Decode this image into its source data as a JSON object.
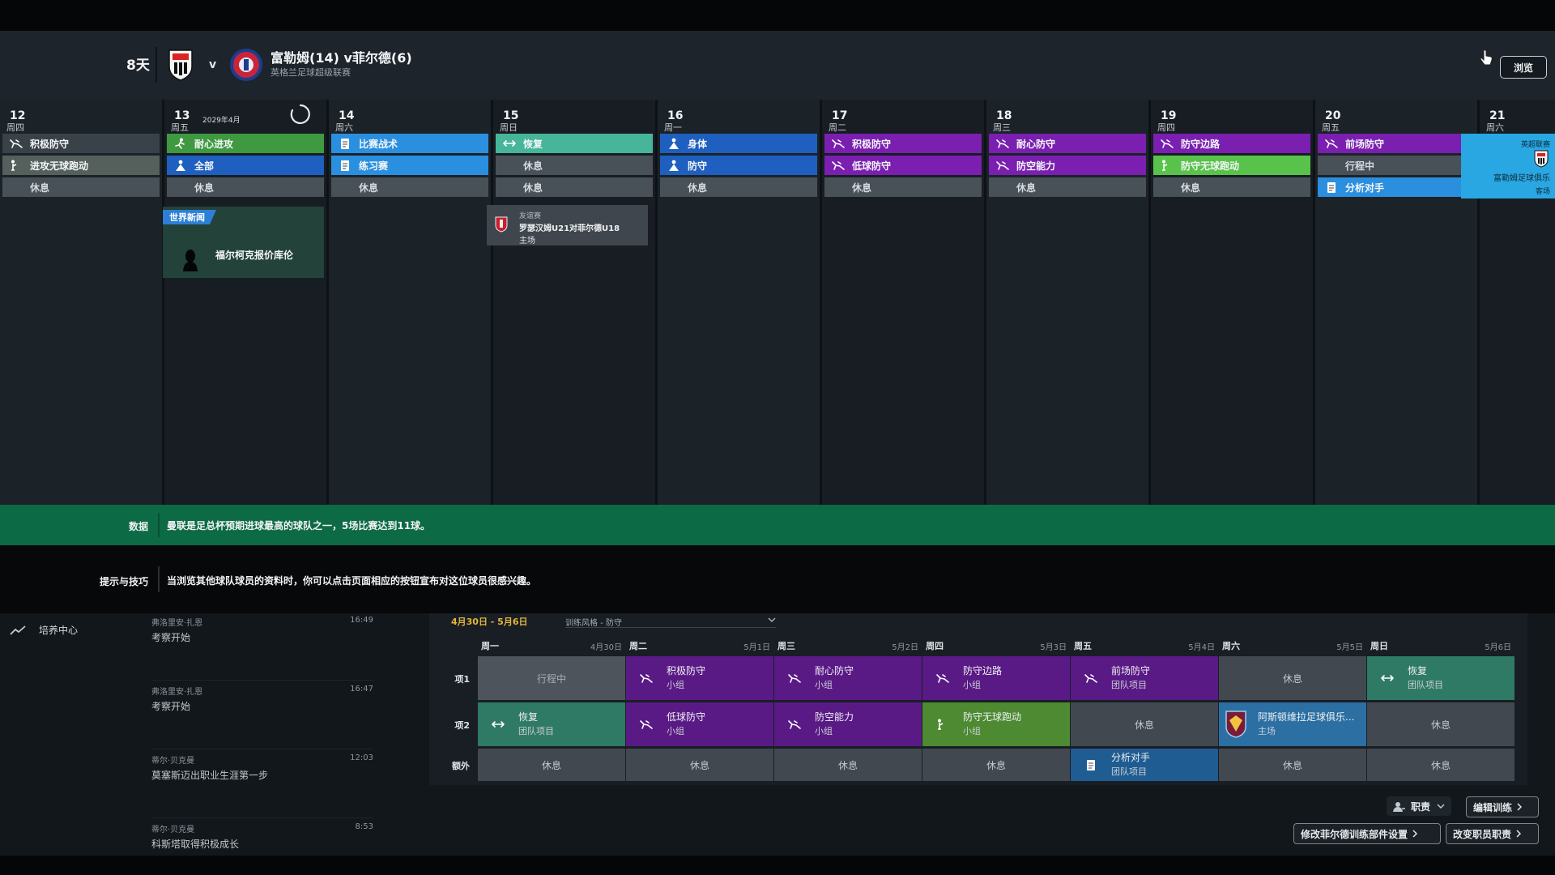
{
  "header": {
    "days_left": "8天",
    "vs": "v",
    "match_title": "富勒姆(14) v菲尔德(6)",
    "match_subtitle": "英格兰足球超级联赛",
    "browse_label": "浏览"
  },
  "calendar": {
    "month_label": "2029年4月",
    "days": [
      {
        "num": "12",
        "weekday": "周四",
        "slots": [
          {
            "label": "积极防守",
            "color": "#3a4249",
            "icon": "defend-icon"
          },
          {
            "label": "进攻无球跑动",
            "color": "#55605c",
            "icon": "run-icon"
          },
          {
            "label": "休息",
            "rest": true
          }
        ]
      },
      {
        "num": "13",
        "weekday": "周五",
        "slots": [
          {
            "label": "耐心进攻",
            "color": "#3f9940",
            "icon": "attack-icon"
          },
          {
            "label": "全部",
            "color": "#1f5fbf",
            "icon": "person-icon"
          },
          {
            "label": "休息",
            "rest": true
          }
        ]
      },
      {
        "num": "14",
        "weekday": "周六",
        "slots": [
          {
            "label": "比赛战术",
            "color": "#2b8fe0",
            "icon": "tactics-icon"
          },
          {
            "label": "练习赛",
            "color": "#2b8fe0",
            "icon": "tactics-icon"
          },
          {
            "label": "休息",
            "rest": true
          }
        ]
      },
      {
        "num": "15",
        "weekday": "周日",
        "slots": [
          {
            "label": "恢复",
            "color": "#46b59a",
            "icon": "recovery-icon"
          },
          {
            "label": "休息",
            "rest": true
          },
          {
            "label": "休息",
            "rest": true
          }
        ]
      },
      {
        "num": "16",
        "weekday": "周一",
        "slots": [
          {
            "label": "身体",
            "color": "#1f5fbf",
            "icon": "person-icon"
          },
          {
            "label": "防守",
            "color": "#1f5fbf",
            "icon": "person-icon"
          },
          {
            "label": "休息",
            "rest": true
          }
        ]
      },
      {
        "num": "17",
        "weekday": "周二",
        "slots": [
          {
            "label": "积极防守",
            "color": "#7a1fb0",
            "icon": "defend-icon"
          },
          {
            "label": "低球防守",
            "color": "#7a1fb0",
            "icon": "defend-icon"
          },
          {
            "label": "休息",
            "rest": true
          }
        ]
      },
      {
        "num": "18",
        "weekday": "周三",
        "slots": [
          {
            "label": "耐心防守",
            "color": "#7a1fb0",
            "icon": "defend-icon"
          },
          {
            "label": "防空能力",
            "color": "#7a1fb0",
            "icon": "defend-icon"
          },
          {
            "label": "休息",
            "rest": true
          }
        ]
      },
      {
        "num": "19",
        "weekday": "周四",
        "slots": [
          {
            "label": "防守边路",
            "color": "#7a1fb0",
            "icon": "defend-icon"
          },
          {
            "label": "防守无球跑动",
            "color": "#58c24a",
            "icon": "run-icon"
          },
          {
            "label": "休息",
            "rest": true
          }
        ]
      },
      {
        "num": "20",
        "weekday": "周五",
        "slots": [
          {
            "label": "前场防守",
            "color": "#7a1fb0",
            "icon": "defend-icon"
          },
          {
            "label": "行程中",
            "rest": true
          },
          {
            "label": "分析对手",
            "color": "#2b8fe0",
            "icon": "tactics-icon"
          }
        ]
      },
      {
        "num": "21",
        "weekday": "周六",
        "slots": []
      }
    ],
    "news": {
      "tag": "世界新闻",
      "text": "福尔柯克报价库伦"
    },
    "friendly": {
      "type": "友谊赛",
      "title": "罗瑟汉姆U21对菲尔德U18",
      "venue": "主场"
    },
    "match_card": {
      "competition": "英超联赛",
      "title": "富勒姆足球俱乐",
      "venue": "客场"
    }
  },
  "banners": {
    "data_label": "数据",
    "data_text": "曼联是足总杯预期进球最高的球队之一，5场比赛达到11球。",
    "tips_label": "提示与技巧",
    "tips_text": "当浏览其他球队球员的资料时，你可以点击页面相应的按钮宣布对这位球员很感兴趣。"
  },
  "sidebar": {
    "item_label": "培养中心"
  },
  "feed": [
    {
      "name": "弗洛里安·扎恩",
      "time": "16:49",
      "text": "考察开始"
    },
    {
      "name": "弗洛里安·扎恩",
      "time": "16:47",
      "text": "考察开始"
    },
    {
      "name": "蒂尔·贝克曼",
      "time": "12:03",
      "text": "莫塞斯迈出职业生涯第一步"
    },
    {
      "name": "蒂尔·贝克曼",
      "time": "8:53",
      "text": "科斯塔取得积极成长"
    }
  ],
  "schedule": {
    "week_range": "4月30日 - 5月6日",
    "style": "训练风格 - 防守",
    "days": [
      {
        "day": "周一",
        "date": "4月30日"
      },
      {
        "day": "周二",
        "date": "5月1日"
      },
      {
        "day": "周三",
        "date": "5月2日"
      },
      {
        "day": "周四",
        "date": "5月3日"
      },
      {
        "day": "周五",
        "date": "5月4日"
      },
      {
        "day": "周六",
        "date": "5月5日"
      },
      {
        "day": "周日",
        "date": "5月6日"
      }
    ],
    "rows": [
      {
        "label": "项1",
        "cells": [
          {
            "kind": "travel",
            "title": "行程中"
          },
          {
            "color": "#5a1a86",
            "icon": "defend-icon",
            "title": "积极防守",
            "sub": "小组"
          },
          {
            "color": "#5a1a86",
            "icon": "defend-icon",
            "title": "耐心防守",
            "sub": "小组"
          },
          {
            "color": "#5a1a86",
            "icon": "defend-icon",
            "title": "防守边路",
            "sub": "小组"
          },
          {
            "color": "#5a1a86",
            "icon": "defend-icon",
            "title": "前场防守",
            "sub": "团队项目"
          },
          {
            "kind": "rest",
            "title": "休息"
          },
          {
            "color": "#2f7a64",
            "icon": "recovery-icon",
            "title": "恢复",
            "sub": "团队项目"
          }
        ]
      },
      {
        "label": "项2",
        "cells": [
          {
            "color": "#2f7a64",
            "icon": "recovery-icon",
            "title": "恢复",
            "sub": "团队项目"
          },
          {
            "color": "#5a1a86",
            "icon": "defend-icon",
            "title": "低球防守",
            "sub": "小组"
          },
          {
            "color": "#5a1a86",
            "icon": "defend-icon",
            "title": "防空能力",
            "sub": "小组"
          },
          {
            "color": "#4e8a32",
            "icon": "run-icon",
            "title": "防守无球跑动",
            "sub": "小组"
          },
          {
            "kind": "rest",
            "title": "休息"
          },
          {
            "color": "#2b6fa3",
            "icon": "crest-icon",
            "title": "阿斯顿维拉足球俱乐...",
            "sub": "主场"
          },
          {
            "kind": "rest",
            "title": "休息"
          }
        ]
      },
      {
        "label": "额外",
        "cells": [
          {
            "kind": "rest",
            "title": "休息"
          },
          {
            "kind": "rest",
            "title": "休息"
          },
          {
            "kind": "rest",
            "title": "休息"
          },
          {
            "kind": "rest",
            "title": "休息"
          },
          {
            "color": "#1f5c91",
            "icon": "tactics-icon",
            "title": "分析对手",
            "sub": "团队项目"
          },
          {
            "kind": "rest",
            "title": "休息"
          },
          {
            "kind": "rest",
            "title": "休息"
          }
        ]
      }
    ]
  },
  "buttons": {
    "duty": "职责",
    "edit_training": "编辑训练",
    "modify_settings": "修改菲尔德训练部件设置",
    "change_staff": "改变职员职责"
  },
  "colors": {
    "accent_green": "#0c6a45",
    "week_range": "#e2b53b",
    "match_blue": "#29a7e3"
  }
}
